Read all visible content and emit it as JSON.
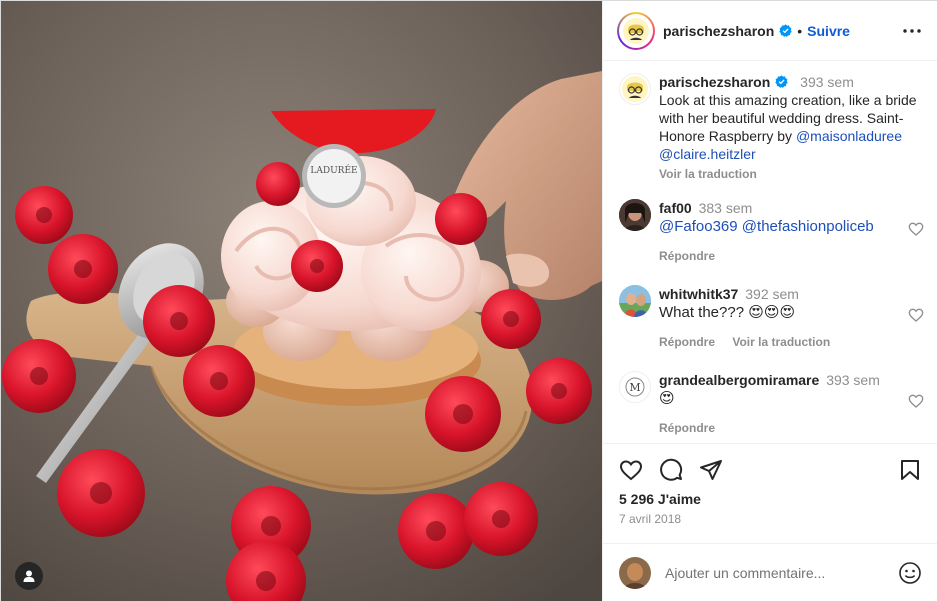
{
  "header": {
    "username": "parischezsharon",
    "dot": "•",
    "follow_label": "Suivre",
    "more_label": "Options"
  },
  "caption": {
    "username": "parischezsharon",
    "time": "393 sem",
    "text": "Look at this amazing creation, like a bride with her beautiful wedding dress. Saint-Honore Raspberry by ",
    "mention_1": "@maisonladuree",
    "mention_2": "@claire.heitzler",
    "translate_label": "Voir la traduction"
  },
  "comments": [
    {
      "username": "faf00",
      "time": "383 sem",
      "mention_1": "@Fafoo369",
      "mention_2": "@thefashionpoliceb",
      "reply_label": "Répondre"
    },
    {
      "username": "whitwhitk37",
      "time": "392 sem",
      "text": "What the??? 😍😍😍",
      "reply_label": "Répondre",
      "translate_label": "Voir la traduction"
    },
    {
      "username": "grandealbergomiramare",
      "time": "393 sem",
      "text": "😍",
      "reply_label": "Répondre"
    }
  ],
  "actions": {
    "likes": "5 296 J'aime",
    "date": "7 avril 2018"
  },
  "composer": {
    "placeholder": "Ajouter un commentaire..."
  },
  "photo": {
    "medallion_text": "LADURÉE"
  },
  "colors": {
    "accent_blue": "#0095f6",
    "link_blue": "#1d4fb8",
    "raspberry": "#d8142a",
    "verified": "#0095f6"
  },
  "icons": [
    "verified-badge-icon",
    "more-options-icon",
    "heart-icon",
    "comment-icon",
    "share-icon",
    "bookmark-icon",
    "emoji-icon",
    "user-tag-icon"
  ]
}
